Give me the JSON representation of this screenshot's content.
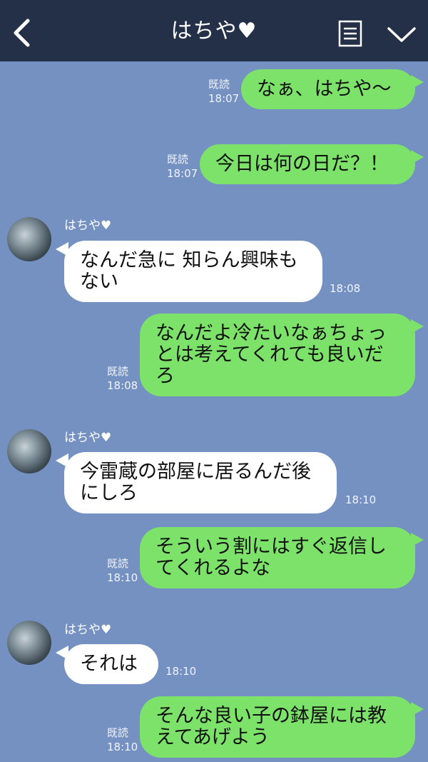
{
  "header": {
    "title": "はちや♥",
    "back_icon": "chevron-left-icon",
    "menu_icon": "list-icon",
    "expand_icon": "chevron-down-icon",
    "bg_color": "#233048"
  },
  "colors": {
    "background": "#7491c2",
    "outgoing_bubble": "#7de26a",
    "incoming_bubble": "#ffffff"
  },
  "messages": [
    {
      "dir": "out",
      "text": "なぁ、はちや〜",
      "read": "既読",
      "time": "18:07"
    },
    {
      "dir": "out",
      "text": "今日は何の日だ？！",
      "read": "既読",
      "time": "18:07"
    },
    {
      "dir": "in",
      "sender": "はちや♥",
      "text": "なんだ急に 知らん興味も\nない",
      "time": "18:08"
    },
    {
      "dir": "out",
      "text": "なんだよ冷たいなぁちょっ\nとは考えてくれても良いだ\nろ",
      "read": "既読",
      "time": "18:08"
    },
    {
      "dir": "in",
      "sender": "はちや♥",
      "text": "今雷蔵の部屋に居るんだ後\nにしろ",
      "time": "18:10"
    },
    {
      "dir": "out",
      "text": "そういう割にはすぐ返信し\nてくれるよな",
      "read": "既読",
      "time": "18:10"
    },
    {
      "dir": "in",
      "sender": "はちや♥",
      "text": "それは",
      "time": "18:10"
    },
    {
      "dir": "out",
      "text": "そんな良い子の鉢屋には教\nえてあげよう",
      "read": "既読",
      "time": "18:10"
    }
  ]
}
